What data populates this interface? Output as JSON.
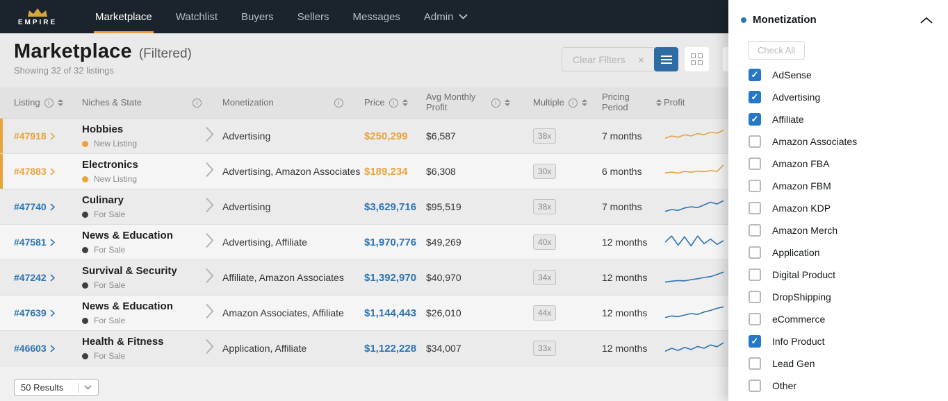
{
  "colors": {
    "orange": "#e8a33d",
    "blue": "#2d74b3",
    "nav_bg": "#1b242c",
    "active_view_button": "#2d6da3",
    "checkbox_blue": "#2577c8",
    "state_new": "#e8a33d",
    "state_for_sale": "#3f3f3f"
  },
  "nav": {
    "brand": "EMPIRE",
    "items": [
      {
        "label": "Marketplace",
        "active": true
      },
      {
        "label": "Watchlist"
      },
      {
        "label": "Buyers"
      },
      {
        "label": "Sellers"
      },
      {
        "label": "Messages"
      },
      {
        "label": "Admin",
        "dropdown": true
      }
    ]
  },
  "header": {
    "title": "Marketplace",
    "subtitle": "(Filtered)",
    "showing": "Showing 32 of 32 listings",
    "clear_filters": "Clear Filters"
  },
  "table": {
    "columns": [
      {
        "label": "Listing",
        "info": true,
        "sort": true
      },
      {
        "label": "Niches & State",
        "info": true,
        "spread": true
      },
      {
        "label": "Monetization",
        "info": true,
        "spread": true
      },
      {
        "label": "Price",
        "info": true,
        "sort": true
      },
      {
        "label": "Avg Monthly Profit",
        "info": true,
        "sort": true
      },
      {
        "label": "Multiple",
        "info": true,
        "sort": true
      },
      {
        "label": "Pricing Period",
        "sort": true
      },
      {
        "label": "Profit"
      }
    ],
    "rows": [
      {
        "id": "#47918",
        "niche": "Hobbies",
        "state": "New Listing",
        "monetization": "Advertising",
        "price": "$250,299",
        "avg_profit": "$6,587",
        "multiple": "38x",
        "period": "7 months",
        "accent": "orange",
        "spark": [
          0.35,
          0.5,
          0.42,
          0.58,
          0.5,
          0.66,
          0.58,
          0.75,
          0.68,
          0.88
        ]
      },
      {
        "id": "#47883",
        "niche": "Electronics",
        "state": "New Listing",
        "monetization": "Advertising, Amazon Associates",
        "price": "$189,234",
        "avg_profit": "$6,308",
        "multiple": "30x",
        "period": "6 months",
        "accent": "orange",
        "spark": [
          0.4,
          0.45,
          0.38,
          0.5,
          0.44,
          0.52,
          0.48,
          0.55,
          0.5,
          0.92
        ]
      },
      {
        "id": "#47740",
        "niche": "Culinary",
        "state": "For Sale",
        "monetization": "Advertising",
        "price": "$3,629,716",
        "avg_profit": "$95,519",
        "multiple": "38x",
        "period": "7 months",
        "accent": "blue",
        "spark": [
          0.2,
          0.32,
          0.26,
          0.42,
          0.5,
          0.44,
          0.62,
          0.8,
          0.68,
          0.9
        ]
      },
      {
        "id": "#47581",
        "niche": "News & Education",
        "state": "For Sale",
        "monetization": "Advertising, Affiliate",
        "price": "$1,970,776",
        "avg_profit": "$49,269",
        "multiple": "40x",
        "period": "12 months",
        "accent": "blue",
        "spark": [
          0.5,
          0.9,
          0.3,
          0.85,
          0.25,
          0.9,
          0.4,
          0.7,
          0.35,
          0.6
        ]
      },
      {
        "id": "#47242",
        "niche": "Survival & Security",
        "state": "For Sale",
        "monetization": "Affiliate, Amazon Associates",
        "price": "$1,392,970",
        "avg_profit": "$40,970",
        "multiple": "34x",
        "period": "12 months",
        "accent": "blue",
        "spark": [
          0.2,
          0.26,
          0.3,
          0.28,
          0.36,
          0.42,
          0.5,
          0.56,
          0.7,
          0.86
        ]
      },
      {
        "id": "#47639",
        "niche": "News & Education",
        "state": "For Sale",
        "monetization": "Amazon Associates, Affiliate",
        "price": "$1,144,443",
        "avg_profit": "$26,010",
        "multiple": "44x",
        "period": "12 months",
        "accent": "blue",
        "spark": [
          0.2,
          0.3,
          0.26,
          0.36,
          0.46,
          0.4,
          0.56,
          0.66,
          0.8,
          0.9
        ]
      },
      {
        "id": "#46603",
        "niche": "Health & Fitness",
        "state": "For Sale",
        "monetization": "Application, Affiliate",
        "price": "$1,122,228",
        "avg_profit": "$34,007",
        "multiple": "33x",
        "period": "12 months",
        "accent": "blue",
        "spark": [
          0.3,
          0.5,
          0.36,
          0.56,
          0.42,
          0.62,
          0.5,
          0.72,
          0.6,
          0.86
        ]
      }
    ]
  },
  "footer": {
    "results": "50 Results"
  },
  "panel": {
    "title": "Monetization",
    "check_all": "Check All",
    "options": [
      {
        "label": "AdSense",
        "checked": true
      },
      {
        "label": "Advertising",
        "checked": true
      },
      {
        "label": "Affiliate",
        "checked": true
      },
      {
        "label": "Amazon Associates",
        "checked": false
      },
      {
        "label": "Amazon FBA",
        "checked": false
      },
      {
        "label": "Amazon FBM",
        "checked": false
      },
      {
        "label": "Amazon KDP",
        "checked": false
      },
      {
        "label": "Amazon Merch",
        "checked": false
      },
      {
        "label": "Application",
        "checked": false
      },
      {
        "label": "Digital Product",
        "checked": false
      },
      {
        "label": "DropShipping",
        "checked": false
      },
      {
        "label": "eCommerce",
        "checked": false
      },
      {
        "label": "Info Product",
        "checked": true
      },
      {
        "label": "Lead Gen",
        "checked": false
      },
      {
        "label": "Other",
        "checked": false
      }
    ]
  }
}
